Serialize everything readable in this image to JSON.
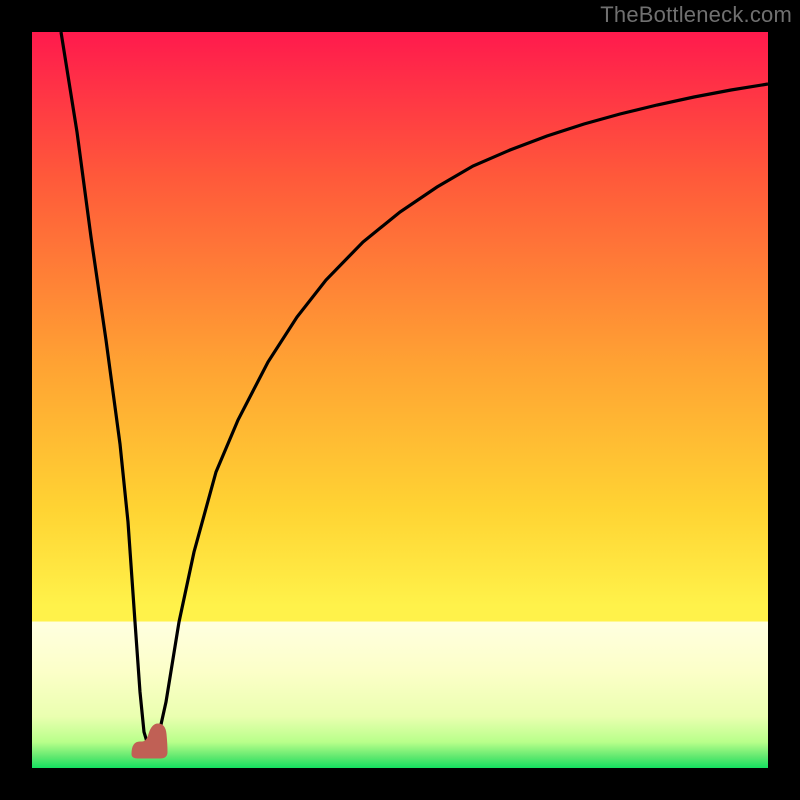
{
  "watermark": "TheBottleneck.com",
  "colors": {
    "frame": "#000000",
    "grad_top": "#ff1a4d",
    "grad_mid_upper": "#ff5a3a",
    "grad_mid": "#ffa233",
    "grad_mid_lower": "#ffd433",
    "grad_yellow": "#fff24a",
    "grad_pale": "#f7ffb0",
    "grad_green": "#14e060",
    "line": "#000000",
    "bump": "#c06055"
  },
  "chart_data": {
    "type": "line",
    "title": "",
    "xlabel": "",
    "ylabel": "",
    "xlim": [
      0,
      100
    ],
    "ylim": [
      0,
      100
    ],
    "series": [
      {
        "name": "bottleneck-curve",
        "x": [
          4,
          6,
          8,
          10,
          12,
          13,
          14,
          15,
          16,
          17,
          18,
          20,
          22,
          25,
          28,
          32,
          36,
          40,
          45,
          50,
          55,
          60,
          65,
          70,
          75,
          80,
          85,
          90,
          95,
          100
        ],
        "values": [
          100,
          86,
          72,
          58,
          44,
          30,
          16,
          4,
          2,
          4,
          12,
          26,
          38,
          50,
          58,
          66,
          72,
          77,
          81,
          84.5,
          87,
          89,
          90.5,
          91.8,
          92.7,
          93.5,
          94.1,
          94.6,
          95.0,
          95.3
        ]
      }
    ],
    "annotations": [
      {
        "name": "optimal-marker",
        "x_start": 13.5,
        "x_end": 17,
        "y": 2,
        "shape": "rounded-bump"
      }
    ],
    "gradient_stops": [
      {
        "pct": 0,
        "color": "#ff1a4d"
      },
      {
        "pct": 20,
        "color": "#ff5a3a"
      },
      {
        "pct": 45,
        "color": "#ffa233"
      },
      {
        "pct": 65,
        "color": "#ffd433"
      },
      {
        "pct": 80,
        "color": "#fff24a"
      },
      {
        "pct": 90,
        "color": "#f7ffb0"
      },
      {
        "pct": 97,
        "color": "#b8ff8a"
      },
      {
        "pct": 100,
        "color": "#14e060"
      }
    ]
  }
}
